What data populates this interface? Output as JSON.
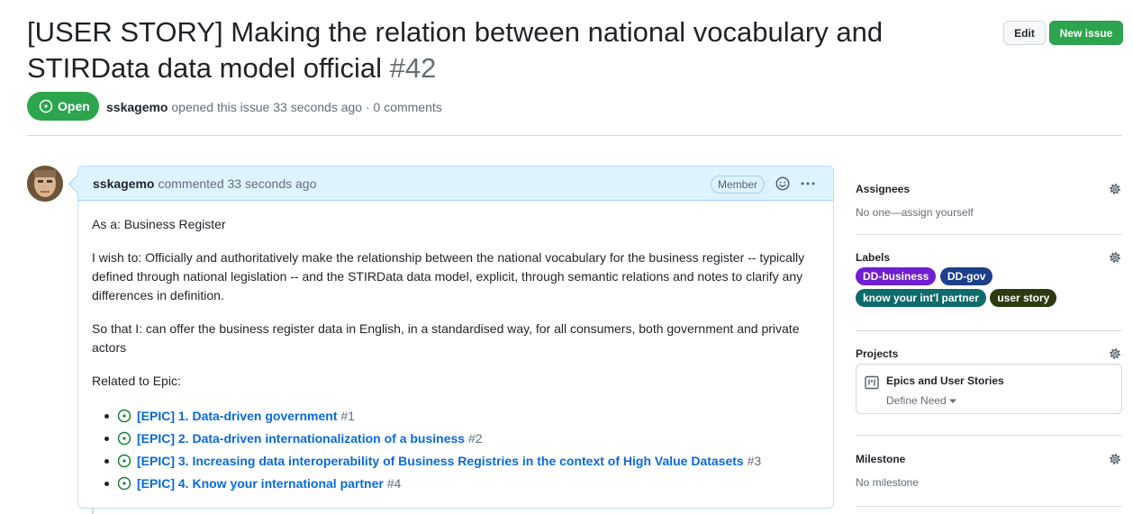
{
  "issue": {
    "title": "[USER STORY] Making the relation between national vocabulary and STIRData data model official",
    "number": "#42",
    "state": "Open",
    "author": "sskagemo",
    "opened_text": "opened this issue 33 seconds ago · 0 comments"
  },
  "header": {
    "edit_label": "Edit",
    "new_issue_label": "New issue"
  },
  "comment": {
    "author": "sskagemo",
    "time_text": "commented 33 seconds ago",
    "role_badge": "Member",
    "as_a": "As a: Business Register",
    "i_wish": "I wish to: Officially and authoritatively make the relationship between the national vocabulary for the business register -- typically defined through national legislation -- and the STIRData data model, explicit, through semantic relations and notes to clarify any differences in definition.",
    "so_that": "So that I: can offer the business register data in English, in a standardised way, for all consumers, both government and private actors",
    "related": "Related to Epic:",
    "epics": [
      {
        "title": "[EPIC] 1. Data-driven government",
        "ref": "#1"
      },
      {
        "title": "[EPIC] 2. Data-driven internationalization of a business",
        "ref": "#2"
      },
      {
        "title": "[EPIC] 3. Increasing data interoperability of Business Registries in the context of High Value Datasets",
        "ref": "#3"
      },
      {
        "title": "[EPIC] 4. Know your international partner",
        "ref": "#4"
      }
    ]
  },
  "sidebar": {
    "assignees": {
      "title": "Assignees",
      "value": "No one—assign yourself"
    },
    "labels": {
      "title": "Labels",
      "items": [
        {
          "name": "DD-business",
          "color": "#6f1fd1"
        },
        {
          "name": "DD-gov",
          "color": "#1d3f8a"
        },
        {
          "name": "know your int'l partner",
          "color": "#0d6b6b"
        },
        {
          "name": "user story",
          "color": "#2b3a10"
        }
      ]
    },
    "projects": {
      "title": "Projects",
      "name": "Epics and User Stories",
      "status": "Define Need"
    },
    "milestone": {
      "title": "Milestone",
      "value": "No milestone"
    }
  },
  "colors": {
    "open_green": "#2da44e",
    "link_blue": "#0969da",
    "comment_header": "#ddf4ff"
  }
}
